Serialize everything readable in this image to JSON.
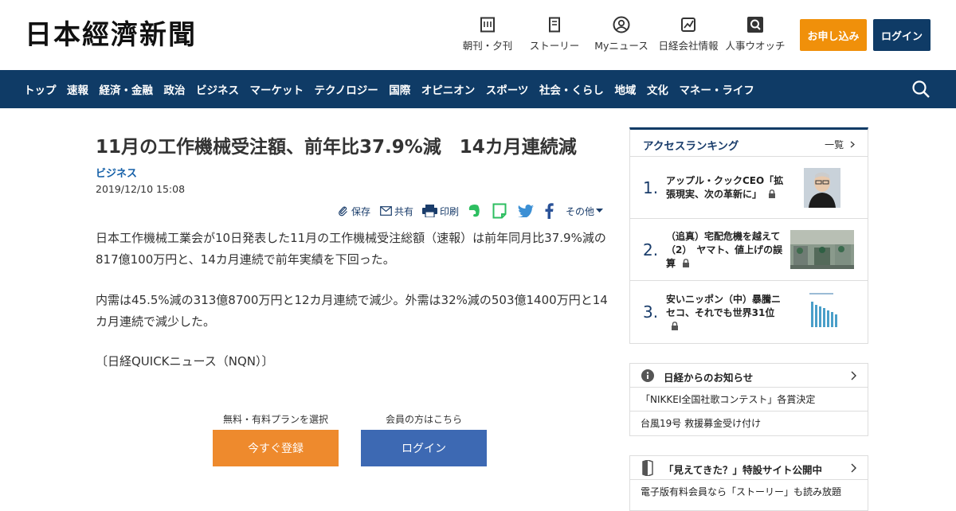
{
  "header": {
    "logo": "日本經濟新聞",
    "nav": [
      {
        "label": "朝刊・夕刊",
        "icon": "newspaper-icon"
      },
      {
        "label": "ストーリー",
        "icon": "story-icon"
      },
      {
        "label": "Myニュース",
        "icon": "user-icon"
      },
      {
        "label": "日経会社情報",
        "icon": "chart-icon"
      },
      {
        "label": "人事ウオッチ",
        "icon": "search-box-icon"
      }
    ],
    "apply_label": "お申し込み",
    "login_label": "ログイン"
  },
  "navbar": {
    "items": [
      "トップ",
      "速報",
      "経済・金融",
      "政治",
      "ビジネス",
      "マーケット",
      "テクノロジー",
      "国際",
      "オピニオン",
      "スポーツ",
      "社会・くらし",
      "地域",
      "文化",
      "マネー・ライフ"
    ]
  },
  "article": {
    "title": "11月の工作機械受注額、前年比37.9%減　14カ月連続減",
    "category": "ビジネス",
    "date": "2019/12/10 15:08",
    "share": {
      "save": "保存",
      "share": "共有",
      "print": "印刷",
      "other": "その他"
    },
    "paragraphs": [
      "日本工作機械工業会が10日発表した11月の工作機械受注総額（速報）は前年同月比37.9%減の817億100万円と、14カ月連続で前年実績を下回った。",
      "内需は45.5%減の313億8700万円と12カ月連続で減少。外需は32%減の503億1400万円と14カ月連続で減少した。",
      "〔日経QUICKニュース（NQN）〕"
    ],
    "cta": {
      "register_caption": "無料・有料プランを選択",
      "register_label": "今すぐ登録",
      "login_caption": "会員の方はこちら",
      "login_label": "ログイン"
    }
  },
  "sidebar": {
    "ranking": {
      "title": "アクセスランキング",
      "more": "一覧",
      "items": [
        {
          "rank": "1.",
          "title": "アップル・クックCEO「拡張現実、次の革新に」"
        },
        {
          "rank": "2.",
          "title": "（追真）宅配危機を越えて（2）　ヤマト、値上げの誤算"
        },
        {
          "rank": "3.",
          "title": "安いニッポン（中）暴騰ニセコ、それでも世界31位"
        }
      ]
    },
    "notice": {
      "title": "日経からのお知らせ",
      "items": [
        "「NIKKEI全国社歌コンテスト」各賞決定",
        "台風19号 救援募金受け付け"
      ]
    },
    "mieru": {
      "title": "「見えてきた？」特設サイト公開中",
      "text": "電子版有料会員なら「ストーリー」も読み放題"
    }
  }
}
